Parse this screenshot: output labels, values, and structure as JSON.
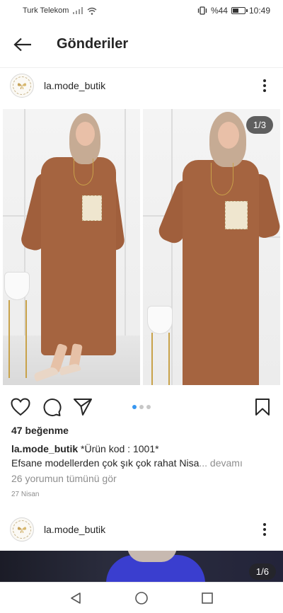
{
  "status_bar": {
    "carrier": "Turk Telekom",
    "battery": "%44",
    "battery_level": 0.44,
    "time": "10:49"
  },
  "header": {
    "title": "Gönderiler",
    "back_icon": "arrow-left-icon"
  },
  "post": {
    "username": "la.mode_butik",
    "image_counter": "1/3",
    "carousel_count": 3,
    "carousel_active_index": 0,
    "likes": "47 beğenme",
    "caption_username": "la.mode_butik",
    "caption_line1": "*Ürün kod : 1001*",
    "caption_line2": "Efsane modellerden  çok şık çok rahat Nisa",
    "caption_more": "... devamı",
    "comments_link": "26 yorumun tümünü gör",
    "date": "27 Nisan",
    "colors": {
      "dress": "#a56440",
      "hijab": "#c6ab94",
      "active_dot": "#3897f0"
    }
  },
  "next_post": {
    "username": "la.mode_butik",
    "image_counter": "1/6"
  },
  "icons": {
    "like": "heart-icon",
    "comment": "comment-icon",
    "share": "send-icon",
    "save": "bookmark-icon",
    "more": "more-vertical-icon"
  },
  "nav": {
    "back": "nav-back-triangle-icon",
    "home": "nav-home-circle-icon",
    "recents": "nav-recents-square-icon"
  }
}
